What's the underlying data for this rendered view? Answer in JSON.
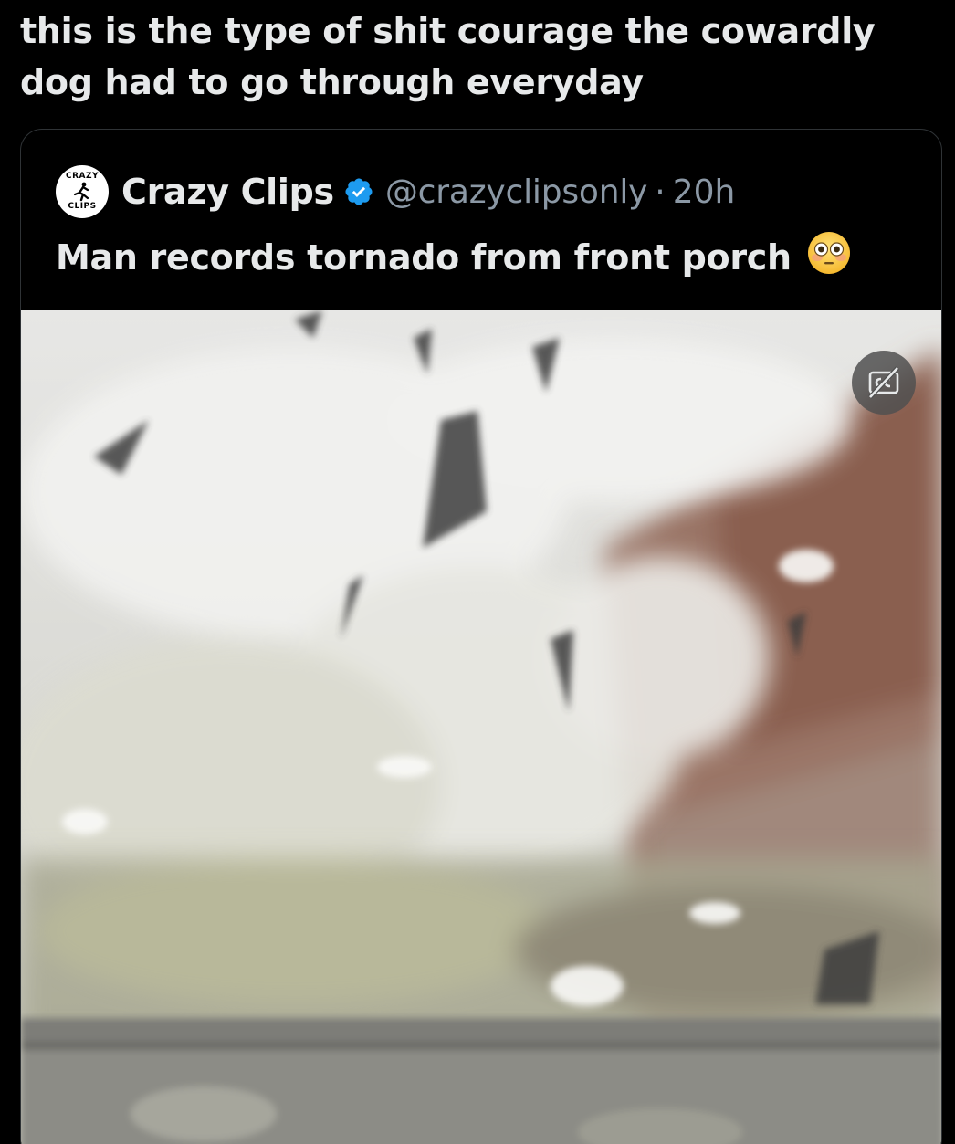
{
  "tweet": {
    "text": "this is the type of shit courage the cowardly dog had to go through everyday"
  },
  "quoted_tweet": {
    "avatar_logo_top": "CRAZY",
    "avatar_logo_bottom": "CLIPS",
    "display_name": "Crazy Clips",
    "verified": true,
    "handle": "@crazyclipsonly",
    "separator": "·",
    "time": "20h",
    "text": "Man records tornado from front porch",
    "emoji": "flushed-face-emoji",
    "media": {
      "type": "video",
      "captions_button": "captions-off"
    }
  },
  "colors": {
    "background": "#000000",
    "text_primary": "#e7e9ea",
    "text_secondary": "#8b98a5",
    "border": "#2f3336",
    "verified_blue": "#1d9bf0"
  }
}
